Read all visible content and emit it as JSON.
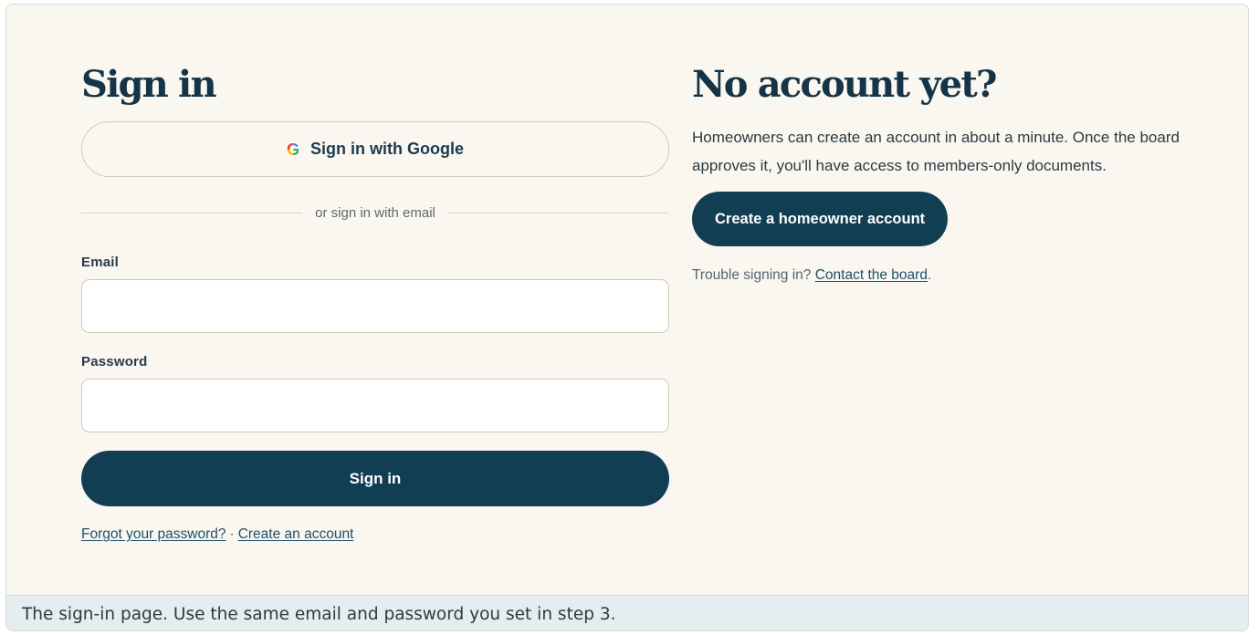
{
  "signin": {
    "heading": "Sign in",
    "google_button_label": "Sign in with Google",
    "google_icon_glyph": "G",
    "divider_text": "or sign in with email",
    "email_label": "Email",
    "email_value": "",
    "password_label": "Password",
    "password_value": "",
    "submit_label": "Sign in",
    "forgot_link": "Forgot your password?",
    "links_separator": "·",
    "create_link": "Create an account"
  },
  "signup": {
    "heading": "No account yet?",
    "body_line1": "Homeowners can create an account in about a minute. Once the board",
    "body_line2": "approves it, you'll have access to members-only documents.",
    "create_button_label": "Create a homeowner account",
    "trouble_prefix": "Trouble signing in?",
    "contact_link": "Contact the board",
    "trouble_suffix": "."
  },
  "caption": {
    "text": "The sign-in page. Use the same email and password you set in step 3."
  },
  "colors": {
    "page_background": "#faf7f1",
    "primary_button": "#123e53",
    "heading_text": "#153446",
    "caption_background": "#e6edf0"
  }
}
